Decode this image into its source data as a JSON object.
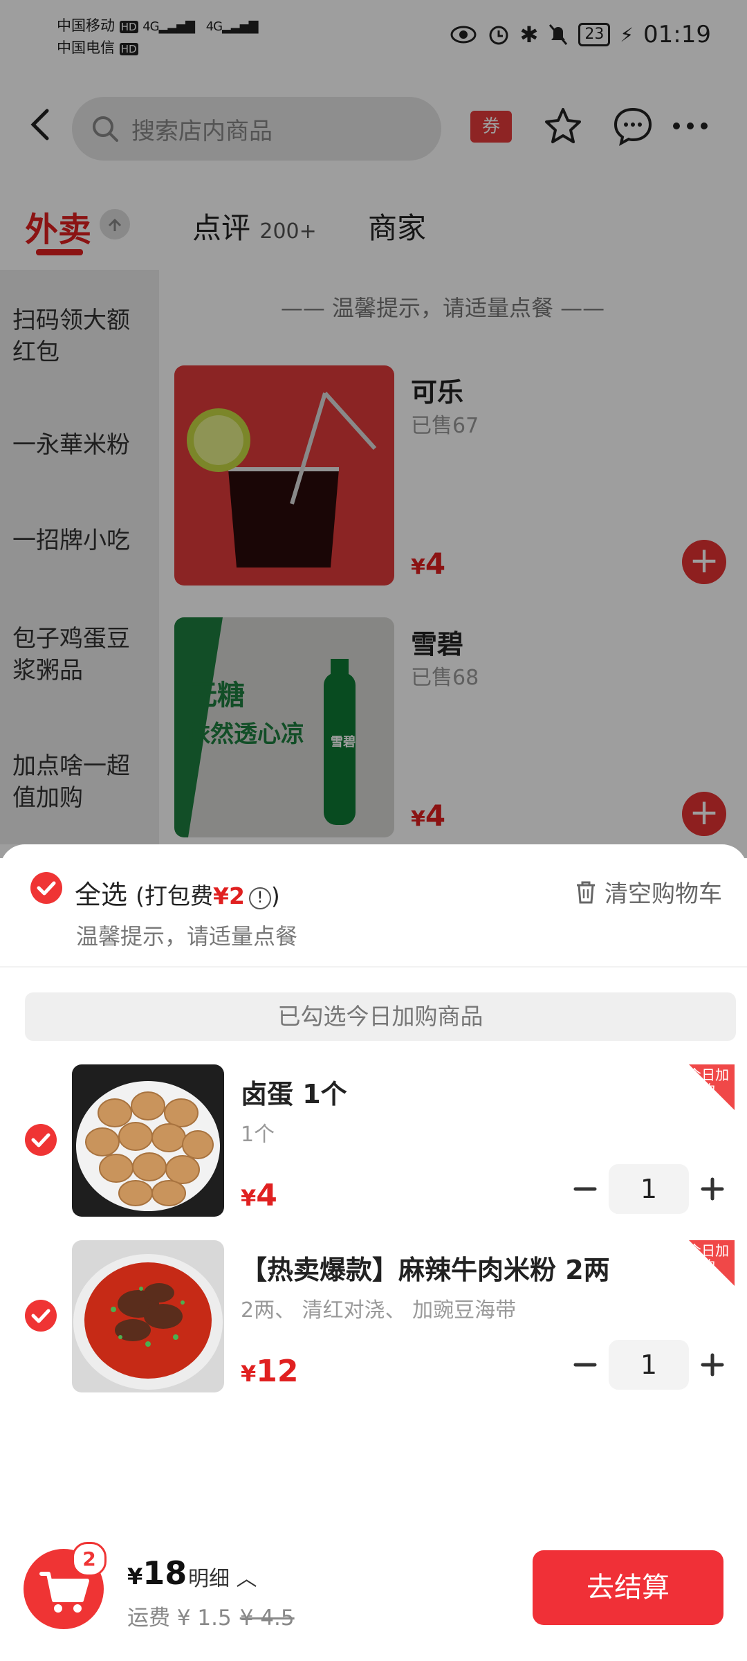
{
  "status": {
    "carrier1": "中国移动",
    "carrier2": "中国电信",
    "hd": "HD",
    "net": "4G",
    "battery": "23",
    "time": "01:19"
  },
  "header": {
    "search_placeholder": "搜索店内商品",
    "coupon": "券"
  },
  "tabs": {
    "takeout": "外卖",
    "reviews": "点评",
    "reviews_count": "200+",
    "merchant": "商家"
  },
  "categories": [
    "扫码领大额红包",
    "一永華米粉",
    "一招牌小吃",
    "包子鸡蛋豆浆粥品",
    "加点啥一超值加购"
  ],
  "menu": {
    "notice": "—— 温馨提示，请适量点餐 ——",
    "items": [
      {
        "name": "可乐",
        "sold": "已售67",
        "currency": "¥",
        "price": "4",
        "add": "+"
      },
      {
        "name": "雪碧",
        "sold": "已售68",
        "currency": "¥",
        "price": "4",
        "add": "+",
        "img_text1": "无糖",
        "img_text2": "依然透心凉",
        "bottle_label": "雪碧"
      }
    ]
  },
  "cart": {
    "select_all": "全选",
    "packaging_prefix": "(打包费",
    "packaging_fee": "¥2",
    "packaging_suffix": ")",
    "clear": "清空购物车",
    "tip": "温馨提示，请适量点餐",
    "group_title": "已勾选今日加购商品",
    "items": [
      {
        "name": "卤蛋 1个",
        "spec": "1个",
        "currency": "¥",
        "price": "4",
        "qty": "1",
        "badge": "今日加购"
      },
      {
        "name": "【热卖爆款】麻辣牛肉米粉 2两",
        "spec": "2两、 清红对浇、 加豌豆海带",
        "currency": "¥",
        "price": "12",
        "qty": "1",
        "badge": "今日加购"
      }
    ]
  },
  "footer": {
    "cart_count": "2",
    "currency": "¥",
    "total": "18",
    "detail": "明细 ︿",
    "delivery_label": "运费 ¥ 1.5",
    "delivery_original": "¥ 4.5",
    "checkout": "去结算"
  },
  "colors": {
    "accent": "#ef3434",
    "price": "#e02020"
  }
}
